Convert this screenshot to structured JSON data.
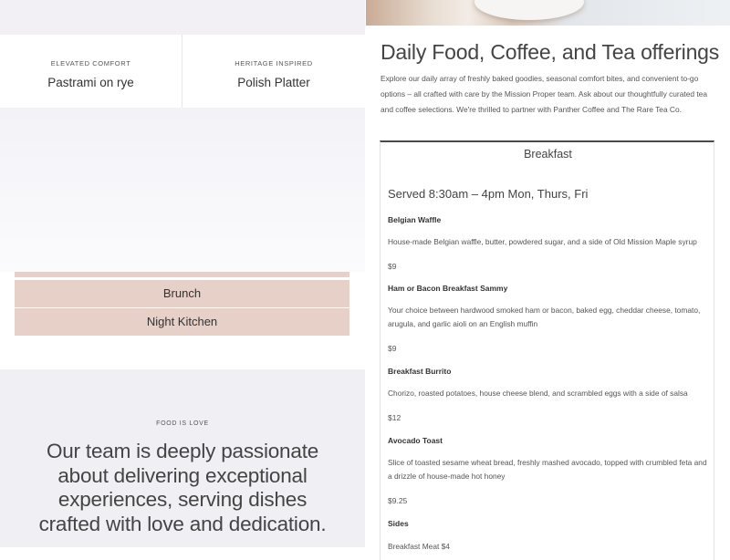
{
  "categories": [
    {
      "kicker": "ELEVATED COMFORT",
      "name": "Pastrami on rye"
    },
    {
      "kicker": "HERITAGE INSPIRED",
      "name": "Polish Platter"
    }
  ],
  "menu_tabs": [
    "Brunch",
    "Night Kitchen"
  ],
  "love": {
    "kicker": "FOOD IS LOVE",
    "text": "Our team is deeply passionate about delivering exceptional experiences, serving dishes crafted with love and dedication."
  },
  "offerings": {
    "title": "Daily Food, Coffee, and Tea offerings",
    "intro": "Explore our daily array of freshly baked goodies, seasonal comfort bites, and convenient to-go options – all crafted with care by the Mission Proper team. Ask about our thoughtfully curated tea and coffee selections. We're thrilled to partner with Panther Coffee and The Rare Tea Co."
  },
  "menu": {
    "heading": "Breakfast",
    "served": "Served 8:30am – 4pm Mon, Thurs, Fri",
    "items": [
      {
        "name": "Belgian Waffle",
        "desc": "House-made Belgian waffle, butter, powdered sugar, and a side of Old Mission Maple syrup",
        "price": "$9"
      },
      {
        "name": "Ham or Bacon Breakfast Sammy",
        "desc": "Your choice between hardwood smoked ham or bacon, baked egg, cheddar cheese, tomato, arugula, and garlic aioli on an English muffin",
        "price": "$9"
      },
      {
        "name": "Breakfast Burrito",
        "desc": "Chorizo, roasted potatoes, house cheese blend, and scrambled eggs with a side of salsa",
        "price": "$12"
      },
      {
        "name": "Avocado Toast",
        "desc": "Slice of toasted sesame wheat bread, freshly mashed avocado, topped with crumbled feta and a drizzle of house-made hot honey",
        "price": "$9.25"
      }
    ],
    "sides_label": "Sides",
    "sides_first": "Breakfast Meat $4"
  }
}
